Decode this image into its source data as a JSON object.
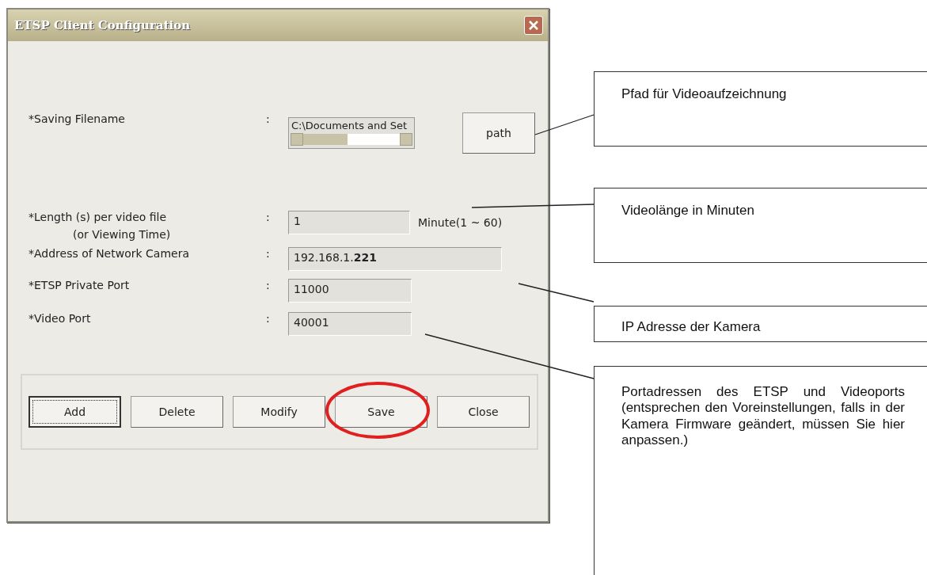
{
  "window": {
    "title": "ETSP Client Configuration"
  },
  "fields": [
    {
      "kind": "path",
      "label": "*Saving Filename",
      "separator": ":",
      "value": "C:\\Documents and Set",
      "button": "path"
    },
    {
      "kind": "unit",
      "label": "*Length (s) per video file",
      "sublabel": "(or Viewing Time)",
      "separator": ":",
      "value": "1",
      "unit": "Minute(1 ~ 60)"
    },
    {
      "kind": "wide",
      "label": "*Address of Network Camera",
      "separator": ":",
      "value": "192.168.1.**221**"
    },
    {
      "kind": "short",
      "label": "*ETSP Private Port",
      "separator": ":",
      "value": "11000"
    },
    {
      "kind": "short",
      "label": "*Video Port",
      "separator": ":",
      "value": "40001"
    }
  ],
  "buttons": [
    {
      "label": "Add",
      "focused": true,
      "circled": false
    },
    {
      "label": "Delete",
      "focused": false,
      "circled": false
    },
    {
      "label": "Modify",
      "focused": false,
      "circled": false
    },
    {
      "label": "Save",
      "focused": false,
      "circled": true
    },
    {
      "label": "Close",
      "focused": false,
      "circled": false
    }
  ],
  "callouts": [
    {
      "text": "Pfad für Videoaufzeichnung"
    },
    {
      "text": "Videolänge in Minuten"
    },
    {
      "text": "IP Adresse der Kamera"
    },
    {
      "text": "Portadressen des ETSP und Videoports (entsprechen den Voreinstellungen, falls in der Kamera Firmware geändert, müssen Sie hier anpassen.)"
    }
  ]
}
